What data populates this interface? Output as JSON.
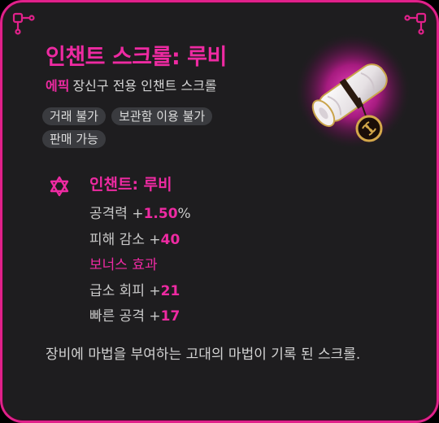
{
  "item": {
    "name": "인챈트 스크롤: 루비",
    "grade": "에픽",
    "type": "장신구 전용 인챈트 스크롤",
    "icon": "ruby-enchant-scroll-icon"
  },
  "tags": [
    "거래 불가",
    "보관함 이용 불가",
    "판매 가능"
  ],
  "enchant": {
    "name": "인챈트: 루비",
    "stats": [
      {
        "label": "공격력 +",
        "value": "1.50",
        "suffix": "%"
      },
      {
        "label": "피해 감소 +",
        "value": "40",
        "suffix": ""
      }
    ],
    "bonus_title": "보너스 효과",
    "bonus_stats": [
      {
        "label": "급소 회피 +",
        "value": "21",
        "suffix": ""
      },
      {
        "label": "빠른 공격 +",
        "value": "17",
        "suffix": ""
      }
    ]
  },
  "description": "장비에 마법을 부여하는 고대의 마법이 기록 된 스크롤.",
  "colors": {
    "accent": "#ee2aa2",
    "frame": "#e0218a",
    "panel": "#1e1d1f",
    "tag_bg": "#3a3b3f"
  }
}
